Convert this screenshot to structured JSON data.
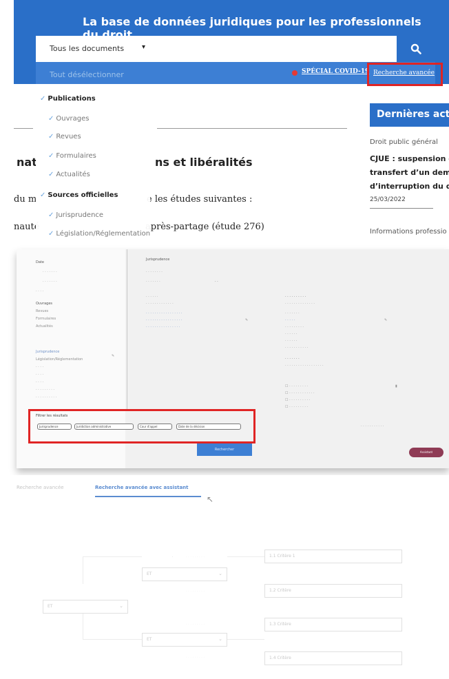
{
  "header": {
    "banner_title": "La base de données juridiques pour les professionnels du droit",
    "doc_select": "Tous les documents",
    "covid_link": "SPÉCIAL COVID-19",
    "advanced_search_link": "Recherche avancée",
    "colors": {
      "brand_blue": "#2a6fc8",
      "highlight_red": "#e02424"
    }
  },
  "dropdown": {
    "deselect_all": "Tout désélectionner",
    "items": [
      {
        "label": "Publications",
        "heading": true
      },
      {
        "label": "Ouvrages",
        "heading": false
      },
      {
        "label": "Revues",
        "heading": false
      },
      {
        "label": "Formulaires",
        "heading": false
      },
      {
        "label": "Actualités",
        "heading": false
      },
      {
        "label": "Sources officielles",
        "heading": true
      },
      {
        "label": "Jurisprudence",
        "heading": false
      },
      {
        "label": "Législation/Réglementation",
        "heading": false
      }
    ]
  },
  "background_article": {
    "title_left": "nat",
    "title_right": "ns et libéralités",
    "line1_left": "du m",
    "line1_right": "e les études suivantes :",
    "line2_left": "nauté",
    "line2_right": "après-partage (étude 276)"
  },
  "news": {
    "heading": "Dernières actua",
    "category": "Droit public général",
    "lines": [
      "CJUE : suspension c",
      "transfert d’un dema",
      "d’interruption du d"
    ],
    "date": "25/03/2022",
    "next_category": "Informations professio"
  },
  "panel2": {
    "sidebar_faint": [
      "Date",
      "Ouvrages",
      "Revues",
      "Formulaires",
      "Actualités",
      "Jurisprudence",
      "Législation/Réglementation"
    ],
    "main_heading": "Jurisprudence",
    "filter_label": "Filtrer les résultats",
    "chips": [
      "Jurisprudence",
      "Juridiction administrative",
      "Cour d'appel",
      "Date de la décision"
    ],
    "search_button": "Rechercher",
    "assistant_button": "Assistant"
  },
  "panel3": {
    "tabs": [
      "Recherche avancée",
      "Recherche avancée avec assistant"
    ],
    "boxes": {
      "b1": "1.1   Critère 1",
      "b2": "ET",
      "b3": "1.2   Critère",
      "b4": "ET",
      "b5": "1.3   Critère",
      "b6": "ET",
      "b7": "1.4   Critère"
    }
  }
}
